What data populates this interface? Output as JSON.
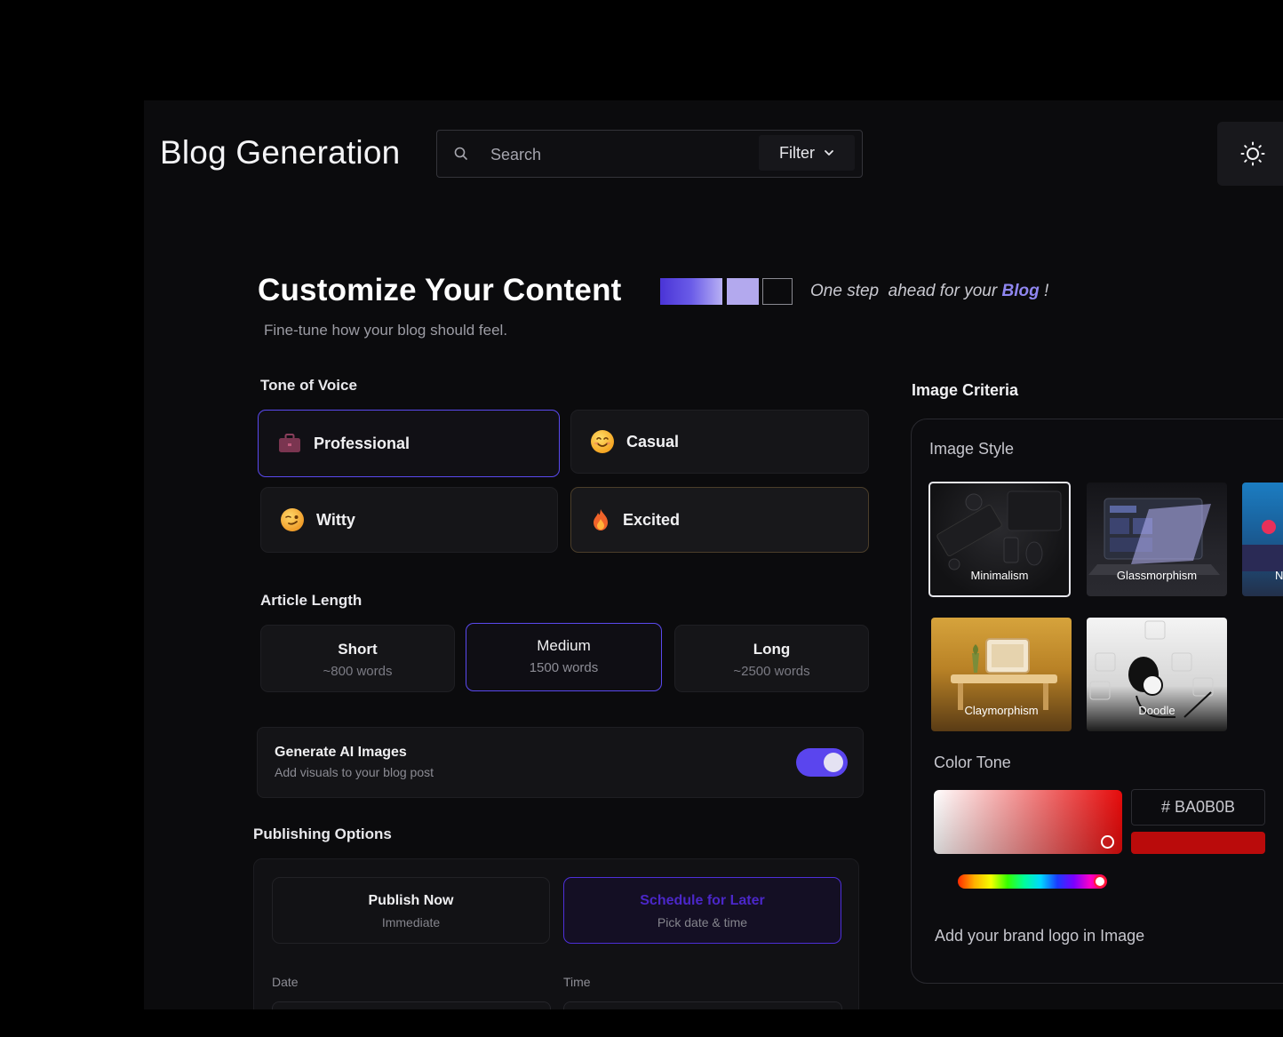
{
  "header": {
    "title": "Blog Generation",
    "search_placeholder": "Search",
    "filter_label": "Filter"
  },
  "hero": {
    "title": "Customize Your Content",
    "tagline_prefix": "One step  ahead for your ",
    "tagline_highlight": "Blog",
    "tagline_suffix": " !",
    "subtitle": "Fine-tune how your blog should feel."
  },
  "tone": {
    "label": "Tone of Voice",
    "options": [
      {
        "label": "Professional",
        "icon": "briefcase-icon",
        "selected": true
      },
      {
        "label": "Casual",
        "icon": "smiling-face-icon",
        "selected": false
      },
      {
        "label": "Witty",
        "icon": "smirking-face-icon",
        "selected": false
      },
      {
        "label": "Excited",
        "icon": "fire-icon",
        "selected": false
      }
    ]
  },
  "length": {
    "label": "Article Length",
    "options": [
      {
        "title": "Short",
        "sub": "~800 words",
        "selected": false
      },
      {
        "title": "Medium",
        "sub": "1500 words",
        "selected": true
      },
      {
        "title": "Long",
        "sub": "~2500 words",
        "selected": false
      }
    ]
  },
  "ai_images": {
    "title": "Generate AI Images",
    "subtitle": "Add visuals to your blog post",
    "enabled": true
  },
  "publishing": {
    "label": "Publishing Options",
    "options": [
      {
        "title": "Publish Now",
        "sub": "Immediate",
        "selected": false
      },
      {
        "title": "Schedule for Later",
        "sub": "Pick date & time",
        "selected": true
      }
    ],
    "date_label": "Date",
    "time_label": "Time"
  },
  "image_criteria": {
    "title": "Image Criteria",
    "style_label": "Image Style",
    "styles": [
      {
        "name": "Minimalism",
        "selected": true
      },
      {
        "name": "Glassmorphism",
        "selected": false
      },
      {
        "name": "N",
        "selected": false
      },
      {
        "name": "Claymorphism",
        "selected": false
      },
      {
        "name": "Doodle",
        "selected": false
      }
    ],
    "color_tone_label": "Color Tone",
    "hex_value": "# BA0B0B",
    "hex_color": "#BA0B0B",
    "logo_label": "Add your brand logo in Image"
  },
  "colors": {
    "accent": "#5A45EE",
    "background": "#0B0B0D",
    "highlight": "#8F86F0"
  }
}
